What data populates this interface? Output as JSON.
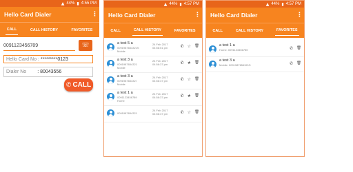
{
  "status_time_1": "4:55 PM",
  "status_time_2": "4:57 PM",
  "status_time_3": "4:57 PM",
  "status_battery": "44%",
  "app_title": "Hello Card Dialer",
  "tabs": [
    "CALL",
    "CALL HISTORY",
    "FAVORITES"
  ],
  "dialer": {
    "number": "0091123456789",
    "hello_label": "Hello Card No :",
    "hello_value": "*********0123",
    "dialer_label": "Dialer No",
    "dialer_value": ": 80043556",
    "call_label": "CALL"
  },
  "history": [
    {
      "name": "a test 5 a",
      "number": "0091987654321S",
      "type": "Mobile",
      "date": "24 Feb 2017",
      "time": "04:56:51 pm",
      "fav": false
    },
    {
      "name": "a test 3 a",
      "number": "0091987654321",
      "type": "Mobile",
      "date": "24 Feb 2017",
      "time": "04:56:37 pm",
      "fav": true
    },
    {
      "name": "a test 3 a",
      "number": "009198765432I",
      "type": "Mobile",
      "date": "24 Feb 2017",
      "time": "04:56:37 pm",
      "fav": false
    },
    {
      "name": "a test 1 a",
      "number": "0091123456789",
      "type": "Home",
      "date": "24 Feb 2017",
      "time": "04:56:37 pm",
      "fav": true
    },
    {
      "name": "",
      "number": "0091987654321",
      "type": "",
      "date": "24 Feb 2017",
      "time": "04:56:37 pm",
      "fav": false
    }
  ],
  "favorites": [
    {
      "name": "a test 1 a",
      "detail": "Home: 0091123456789"
    },
    {
      "name": "a test 3 a",
      "detail": "Mobile: 0091987654321S"
    }
  ],
  "icons": {
    "phone": "phone-icon",
    "star": "star-icon",
    "delete": "trash-icon",
    "contacts": "contacts-icon",
    "overflow": "overflow-menu-icon"
  },
  "colors": {
    "primary": "#f7841f",
    "status": "#e8651a",
    "call_button": "#f05a28",
    "avatar": "#2d8fd5"
  }
}
